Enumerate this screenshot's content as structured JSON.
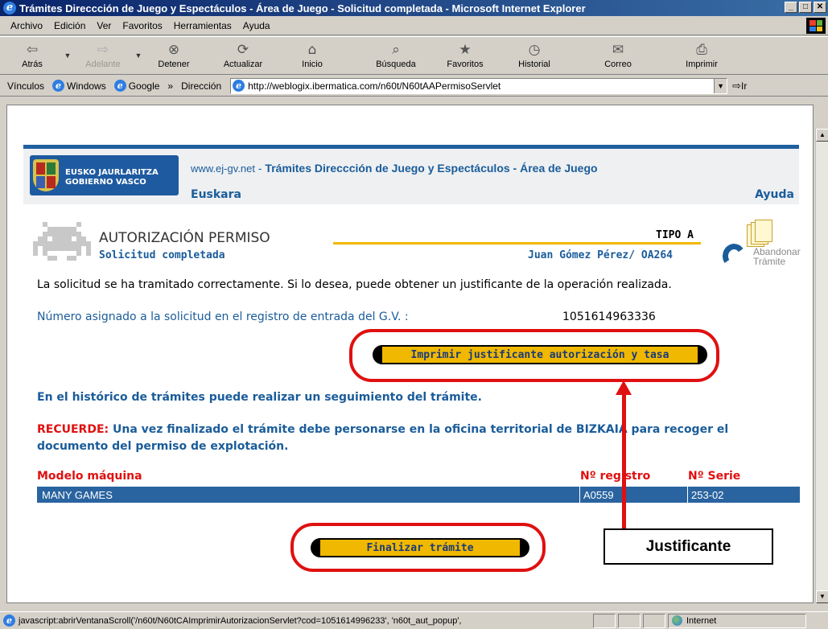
{
  "window": {
    "title": "Trámites Direccción de Juego y Espectáculos - Área de Juego - Solicitud completada - Microsoft Internet Explorer",
    "minimize": "_",
    "maximize": "□",
    "close": "✕"
  },
  "menu": [
    "Archivo",
    "Edición",
    "Ver",
    "Favoritos",
    "Herramientas",
    "Ayuda"
  ],
  "toolbar": {
    "back": "Atrás",
    "forward": "Adelante",
    "stop": "Detener",
    "refresh": "Actualizar",
    "home": "Inicio",
    "search": "Búsqueda",
    "favorites": "Favoritos",
    "history": "Historial",
    "mail": "Correo",
    "print": "Imprimir"
  },
  "links_bar": {
    "label": "Vínculos",
    "items": [
      "Windows",
      "Google"
    ],
    "chevron": "»"
  },
  "address": {
    "label": "Dirección",
    "url": "http://weblogix.ibermatica.com/n60t/N60tAAPermisoServlet",
    "go": "Ir"
  },
  "header": {
    "logo_line1": "EUSKO JAURLARITZA",
    "logo_line2": "GOBIERNO VASCO",
    "site_url": "www.ej-gv.net",
    "site_sep": " - ",
    "site_title": "Trámites Direccción de Juego y Espectáculos - Área de Juego",
    "euskara": "Euskara",
    "ayuda": "Ayuda"
  },
  "form": {
    "title": "AUTORIZACIÓN PERMISO",
    "subtitle": "Solicitud completada",
    "tipo": "TIPO A",
    "user": "Juan Gómez Pérez/ OA264",
    "abandon_line1": "Abandonar",
    "abandon_line2": "Trámite"
  },
  "content": {
    "success_text": "La solicitud se ha tramitado correctamente. Si lo desea, puede obtener un justificante de la operación realizada.",
    "number_label": "Número asignado a la solicitud en el registro de entrada del G.V. :",
    "number_value": "1051614963336",
    "print_button": "Imprimir justificante autorización y tasa",
    "history_text": "En el histórico de trámites puede realizar un seguimiento del trámite.",
    "remember_label": "RECUERDE:",
    "remember_text": " Una vez finalizado el trámite debe personarse en la oficina territorial de BIZKAIA para recoger el documento del permiso de explotación.",
    "finish_button": "Finalizar trámite"
  },
  "table": {
    "headers": [
      "Modelo máquina",
      "Nº registro",
      "Nº Serie"
    ],
    "rows": [
      [
        "MANY GAMES",
        "A0559",
        "253-02"
      ]
    ]
  },
  "annotation": {
    "callout": "Justificante",
    "color": "#e01010"
  },
  "status": {
    "text": "javascript:abrirVentanaScroll('/n60t/N60tCAImprimirAutorizacionServlet?cod=1051614996233', 'n60t_aut_popup',",
    "zone": "Internet"
  },
  "colors": {
    "brand_blue": "#1a5c9a",
    "accent_yellow": "#f0b800",
    "alert_red": "#e01010",
    "row_blue": "#2a64a0"
  }
}
